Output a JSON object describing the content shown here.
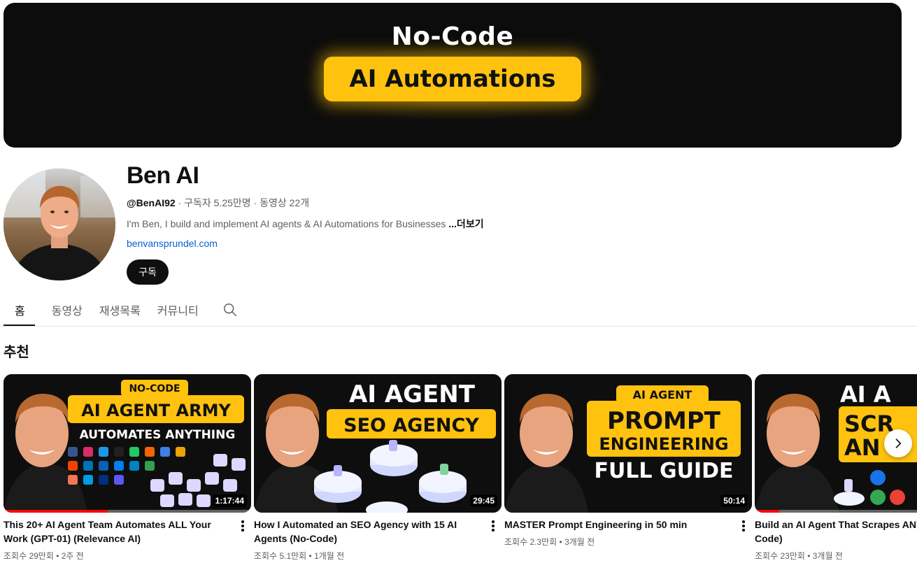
{
  "banner": {
    "top_text": "No-Code",
    "pill_text": "AI Automations",
    "accent": "#ffc20e"
  },
  "channel": {
    "name": "Ben AI",
    "handle": "@BenAI92",
    "subscribers": "구독자 5.25만명",
    "video_count": "동영상 22개",
    "separator": " · ",
    "description": "I'm Ben, I build and implement AI agents & AI Automations for Businesses ",
    "more_label": "...더보기",
    "link": "benvansprundel.com",
    "subscribe_label": "구독"
  },
  "tabs": [
    {
      "label": "홈",
      "active": true
    },
    {
      "label": "동영상"
    },
    {
      "label": "재생목록"
    },
    {
      "label": "커뮤니티"
    }
  ],
  "icons": {
    "search": "search-icon",
    "next": "chevron-right-icon",
    "more": "more-vert-icon"
  },
  "section_title": "추천",
  "videos": [
    {
      "title": "This 20+ AI Agent Team Automates ALL Your Work (GPT-01) (Relevance AI)",
      "meta": "조회수 29만회 • 2주 전",
      "duration": "1:17:44",
      "watched": 0.42,
      "thumb": {
        "badge": "NO-CODE",
        "line1": "AI AGENT ARMY",
        "line2": "AUTOMATES ANYTHING"
      }
    },
    {
      "title": "How I Automated an SEO Agency with 15 AI Agents (No-Code)",
      "meta": "조회수 5.1만회 • 1개월 전",
      "duration": "29:45",
      "watched": 0,
      "thumb": {
        "line1": "AI AGENT",
        "line2": "SEO AGENCY"
      }
    },
    {
      "title": "MASTER Prompt Engineering in 50 min",
      "meta": "조회수 2.3만회 • 3개월 전",
      "duration": "50:14",
      "watched": 0,
      "thumb": {
        "badge": "AI AGENT",
        "line1": "PROMPT",
        "line2": "ENGINEERING",
        "line3": "FULL GUIDE"
      }
    },
    {
      "title": "Build an AI Agent That Scrapes ANY Website (No-Code)",
      "meta": "조회수 23만회 • 3개월 전",
      "duration": "",
      "watched": 0.1,
      "thumb": {
        "line1": "AI A",
        "line2": "SCR",
        "line3": "AN"
      }
    }
  ]
}
